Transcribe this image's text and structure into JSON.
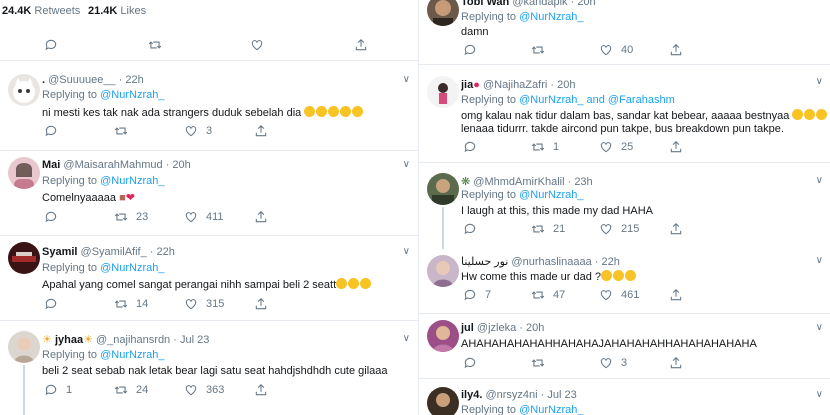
{
  "left": {
    "stats": {
      "retweets_count": "24.4K",
      "retweets_label": "Retweets",
      "likes_count": "21.4K",
      "likes_label": "Likes"
    },
    "tweets": [
      {
        "name": ".",
        "handle": "@Suuuuee__",
        "time": "· 22h",
        "replying_prefix": "Replying to",
        "replying_to": "@NurNzrah_",
        "text": "ni mesti kes tak nak ada strangers duduk sebelah dia",
        "emoji_count": 5,
        "replies": "",
        "retweets": "",
        "likes": "3"
      },
      {
        "name": "Mai",
        "handle": "@MaisarahMahmud",
        "time": "· 20h",
        "replying_prefix": "Replying to",
        "replying_to": "@NurNzrah_",
        "text": "Comelnyaaaaa",
        "emoji_count": 2,
        "replies": "",
        "retweets": "23",
        "likes": "411"
      },
      {
        "name": "Syamil",
        "handle": "@SyamilAfif_",
        "time": "· 22h",
        "replying_prefix": "Replying to",
        "replying_to": "@NurNzrah_",
        "text": "Apahal yang comel sangat perangai nihh sampai beli 2 seatt",
        "emoji_count": 3,
        "replies": "",
        "retweets": "14",
        "likes": "315"
      },
      {
        "name": "jyhaa",
        "handle": "@_najihansrdn",
        "time": "· Jul 23",
        "replying_prefix": "Replying to",
        "replying_to": "@NurNzrah_",
        "text": "beli 2 seat sebab nak letak bear lagi satu seat hahdjshdhdh cute gilaaa",
        "emoji_count": 0,
        "replies": "1",
        "retweets": "24",
        "likes": "363"
      }
    ]
  },
  "right": {
    "tweets": [
      {
        "name": "Tobi Wan",
        "handle": "@kandapik",
        "time": "· 20h",
        "replying_prefix": "Replying to",
        "replying_to": "@NurNzrah_",
        "text": "damn",
        "replies": "",
        "retweets": "",
        "likes": "40"
      },
      {
        "name": "jia",
        "handle": "@NajihaZafri",
        "time": "· 20h",
        "replying_prefix": "Replying to",
        "replying_to": "@NurNzrah_ and @Farahashm",
        "text": "omg kalau nak tidur dalam bas, sandar kat bebear, aaaaa bestnyaa",
        "text2": "lenaaa tidurrr. takde aircond pun takpe, bus breakdown pun takpe.",
        "replies": "",
        "retweets": "1",
        "likes": "25"
      },
      {
        "name": "",
        "handle": "@MhmdAmirKhalil",
        "time": "· 23h",
        "replying_prefix": "Replying to",
        "replying_to": "@NurNzrah_",
        "text": "I laugh at this, this made my dad HAHA",
        "replies": "",
        "retweets": "21",
        "likes": "215"
      },
      {
        "name": "نور حسلينا",
        "handle": "@nurhaslinaaaa",
        "time": "· 22h",
        "replying_prefix": "",
        "replying_to": "",
        "text": "Hw come this made ur dad ?",
        "replies": "7",
        "retweets": "47",
        "likes": "461"
      },
      {
        "name": "jul",
        "handle": "@jzleka",
        "time": "· 20h",
        "replying_prefix": "Replying to",
        "replying_to": "@NurNzrah_",
        "text": "AHAHAHAHAHAHHAHAHAJAHAHAHAHHAHAHAHAHAHA",
        "replies": "",
        "retweets": "",
        "likes": "3"
      },
      {
        "name": "ily4.",
        "handle": "@nrsyz4ni",
        "time": "· Jul 23",
        "replying_prefix": "Replying to",
        "replying_to": "@NurNzrah_",
        "text": "",
        "replies": "",
        "retweets": "",
        "likes": ""
      }
    ]
  },
  "colors": {
    "accent": "#1da1f2",
    "muted": "#657786",
    "text": "#14171a",
    "border": "#e6ecf0"
  }
}
